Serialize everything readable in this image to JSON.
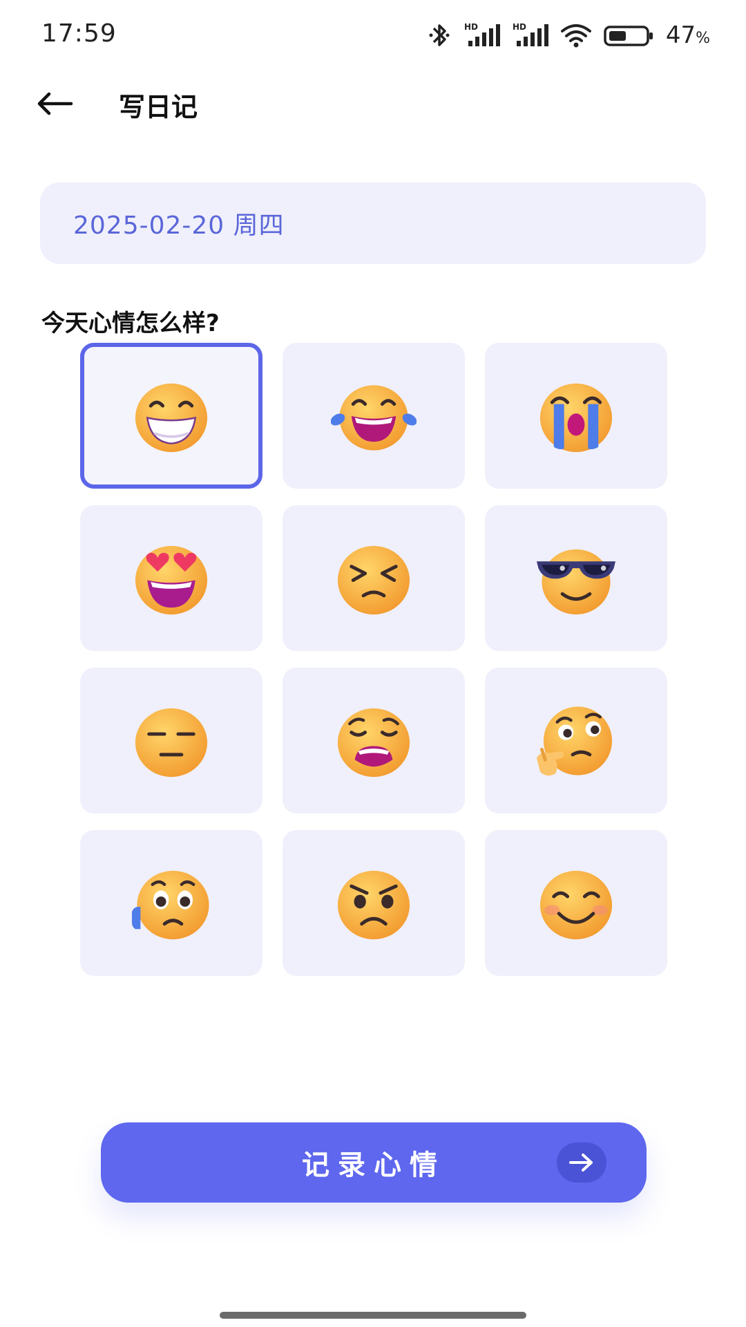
{
  "status_bar": {
    "time": "17:59",
    "battery_percent": "47",
    "battery_unit": "%",
    "icons": [
      "bluetooth-icon",
      "signal-hd-icon",
      "signal-hd-icon",
      "wifi-icon",
      "battery-icon"
    ],
    "battery_level": 0.47
  },
  "header": {
    "title": "写日记",
    "back_icon": "back-arrow-icon"
  },
  "date": {
    "value": "2025-02-20 周四"
  },
  "mood": {
    "question": "今天心情怎么样?",
    "selected_index": 0,
    "options": [
      {
        "icon": "grinning-face-icon"
      },
      {
        "icon": "tears-of-joy-face-icon"
      },
      {
        "icon": "crying-face-icon"
      },
      {
        "icon": "heart-eyes-face-icon"
      },
      {
        "icon": "tired-squint-face-icon"
      },
      {
        "icon": "sunglasses-face-icon"
      },
      {
        "icon": "expressionless-face-icon"
      },
      {
        "icon": "weary-face-icon"
      },
      {
        "icon": "thinking-face-icon"
      },
      {
        "icon": "anxious-sweat-face-icon"
      },
      {
        "icon": "angry-face-icon"
      },
      {
        "icon": "smiling-face-icon"
      }
    ]
  },
  "submit": {
    "label": "记录心情",
    "icon": "arrow-right-icon"
  },
  "colors": {
    "accent": "#5e67ee",
    "cell_bg": "#f0f0fc",
    "date_text": "#5a66d8",
    "face": "#f7b733"
  }
}
